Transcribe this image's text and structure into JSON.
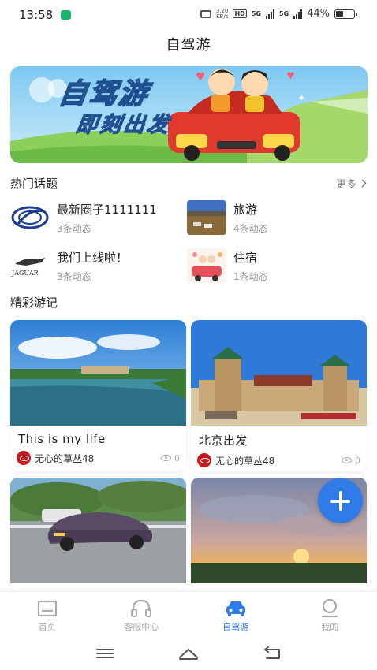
{
  "status_bar": {
    "time": "13:58",
    "net_speed": "3.20",
    "net_unit": "KB/s",
    "hd": "HD",
    "sim1": "5G",
    "sim2": "5G",
    "battery": "44%",
    "battery_level": 0.44
  },
  "header": {
    "title": "自驾游"
  },
  "banner": {
    "title": "自驾游",
    "subtitle": "即刻出发"
  },
  "hot_topics": {
    "heading": "热门话题",
    "more": "更多",
    "items": [
      {
        "name": "最新圈子1111111",
        "count": "3条动态",
        "icon": "globe-logo"
      },
      {
        "name": "旅游",
        "count": "4条动态",
        "icon": "landscape-photo"
      },
      {
        "name": "我们上线啦！",
        "count": "3条动态",
        "icon": "jaguar-logo"
      },
      {
        "name": "住宿",
        "count": "1条动态",
        "icon": "wedding-car-photo"
      }
    ]
  },
  "travelogues": {
    "heading": "精彩游记",
    "items": [
      {
        "title": "This is my life",
        "author": "无心的草丛48",
        "views": "0",
        "image": "lake-photo"
      },
      {
        "title": "北京出发",
        "author": "无心的草丛48",
        "views": "0",
        "image": "beijing-station-photo"
      },
      {
        "title": "",
        "author": "",
        "views": "",
        "image": "car-on-road-photo"
      },
      {
        "title": "",
        "author": "",
        "views": "",
        "image": "sunset-photo"
      }
    ]
  },
  "tab_bar": {
    "items": [
      {
        "label": "首页",
        "icon": "home-icon",
        "active": false
      },
      {
        "label": "客服中心",
        "icon": "headset-icon",
        "active": false
      },
      {
        "label": "自驾游",
        "icon": "car-icon",
        "active": true
      },
      {
        "label": "我的",
        "icon": "profile-icon",
        "active": false
      }
    ]
  },
  "colors": {
    "accent": "#2f7be8",
    "inactive": "#aaaaaa",
    "avatar": "#c8191e"
  }
}
